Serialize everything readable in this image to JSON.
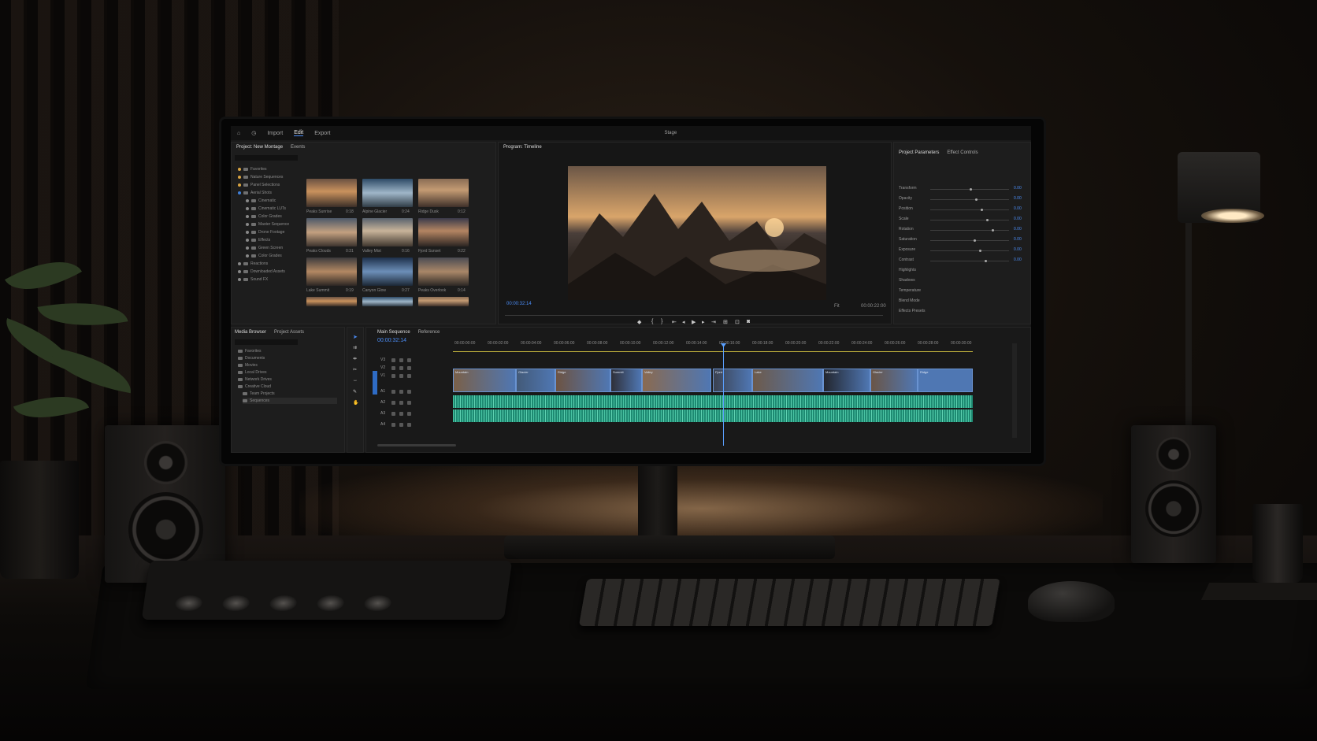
{
  "app": {
    "nav": {
      "home": "",
      "import": "Import",
      "edit": "Edit",
      "export": "Export"
    },
    "title": "Stage"
  },
  "project": {
    "tab_label": "Project: New Montage",
    "tab2_label": "Events",
    "bins": [
      "Favorites",
      "Nature Sequences",
      "Panel Selections",
      "Aerial Shots",
      "Cinematic",
      "Cinematic LUTs",
      "Color Grades",
      "Master Sequence",
      "Drone Footage",
      "Effects",
      "Green Screen",
      "Color Grades",
      "Reactions",
      "Downloaded Assets",
      "Sound FX"
    ],
    "thumbnails": [
      {
        "caption": "Peaks Sunrise",
        "duration": "0:18"
      },
      {
        "caption": "Alpine Glacier",
        "duration": "0:24"
      },
      {
        "caption": "Ridge Dusk",
        "duration": "0:12"
      },
      {
        "caption": "Peaks Clouds",
        "duration": "0:31"
      },
      {
        "caption": "Valley Mist",
        "duration": "0:16"
      },
      {
        "caption": "Fjord Sunset",
        "duration": "0:22"
      },
      {
        "caption": "Lake Summit",
        "duration": "0:19"
      },
      {
        "caption": "Canyon Glow",
        "duration": "0:27"
      },
      {
        "caption": "Peaks Overlook",
        "duration": "0:14"
      },
      {
        "caption": "",
        "duration": ""
      },
      {
        "caption": "",
        "duration": ""
      },
      {
        "caption": "",
        "duration": ""
      }
    ]
  },
  "viewer": {
    "tab_label": "Program: Timeline",
    "timecode": "00:00:32:14",
    "duration": "00:00:22:00",
    "zoom": "Fit"
  },
  "inspector": {
    "tab_label": "Project Parameters",
    "tab2_label": "Effect Controls",
    "sections": [
      "Transform",
      "Opacity",
      "Position",
      "Scale",
      "Rotation",
      "Saturation",
      "Exposure",
      "Contrast",
      "Highlights",
      "Shadows",
      "Temperature",
      "Blend Mode",
      "Effects Presets"
    ],
    "values": [
      "0.00",
      "0.00",
      "0.00",
      "0.00",
      "0.00",
      "0.00",
      "0.00",
      "0.00"
    ]
  },
  "media_browser": {
    "tab_label": "Media Browser",
    "tab2_label": "Project Assets",
    "items": [
      "Favorites",
      "Documents",
      "Movies",
      "Local Drives",
      "Network Drives",
      "Creative Cloud",
      "Team Projects",
      "Sequences"
    ]
  },
  "timeline": {
    "tab_label": "Main Sequence",
    "tab2_label": "Reference",
    "timecode": "00:00:32:14",
    "ruler": [
      "00:00:00:00",
      "00:00:02:00",
      "00:00:04:00",
      "00:00:06:00",
      "00:00:08:00",
      "00:00:10:00",
      "00:00:12:00",
      "00:00:14:00",
      "00:00:16:00",
      "00:00:18:00",
      "00:00:20:00",
      "00:00:22:00",
      "00:00:24:00",
      "00:00:26:00",
      "00:00:28:00",
      "00:00:30:00"
    ],
    "video_tracks": [
      "V3",
      "V2",
      "V1"
    ],
    "audio_tracks": [
      "A1",
      "A2",
      "A3",
      "A4"
    ],
    "clips": [
      "Mountain",
      "Glacier",
      "Ridge",
      "Summit",
      "Valley",
      "Fjord",
      "Lake"
    ]
  },
  "colors": {
    "accent": "#4b8df6",
    "clip_video": "#4f77b3",
    "clip_audio": "#1e8a72",
    "playhead": "#5aa0ff"
  }
}
